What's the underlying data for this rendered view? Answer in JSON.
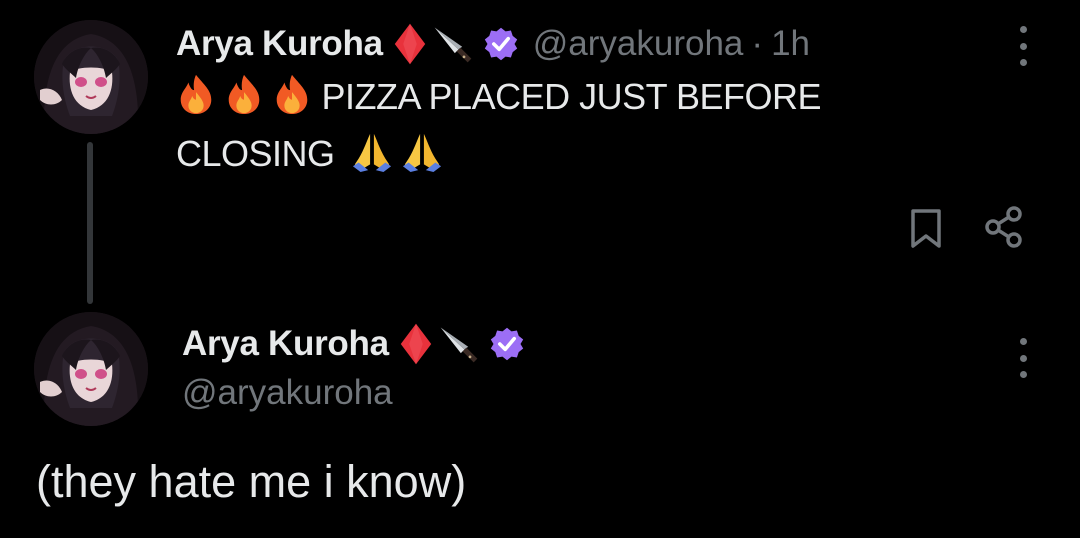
{
  "colors": {
    "background": "#000000",
    "primary_text": "#e7e9ea",
    "secondary_text": "#71767b",
    "verified_badge": "#9c6ef5",
    "thread_line": "#333639",
    "diamond": "#e8323c"
  },
  "main_post": {
    "author": {
      "display_name": "Arya Kuroha",
      "handle": "@aryakuroha",
      "verified": true,
      "name_emojis": [
        "red-diamond",
        "kitchen-knife"
      ]
    },
    "separator": "·",
    "timestamp": "1h",
    "text_line_1": "PIZZA PLACED JUST BEFORE",
    "text_line_2": "CLOSING",
    "lead_emojis": [
      "fire",
      "fire",
      "fire"
    ],
    "trail_emojis": [
      "folded-hands",
      "folded-hands"
    ],
    "actions": [
      "bookmark-icon",
      "share-icon"
    ]
  },
  "reply_post": {
    "author": {
      "display_name": "Arya Kuroha",
      "handle": "@aryakuroha",
      "verified": true,
      "name_emojis": [
        "red-diamond",
        "kitchen-knife"
      ]
    },
    "text": "(they hate me i know)"
  }
}
